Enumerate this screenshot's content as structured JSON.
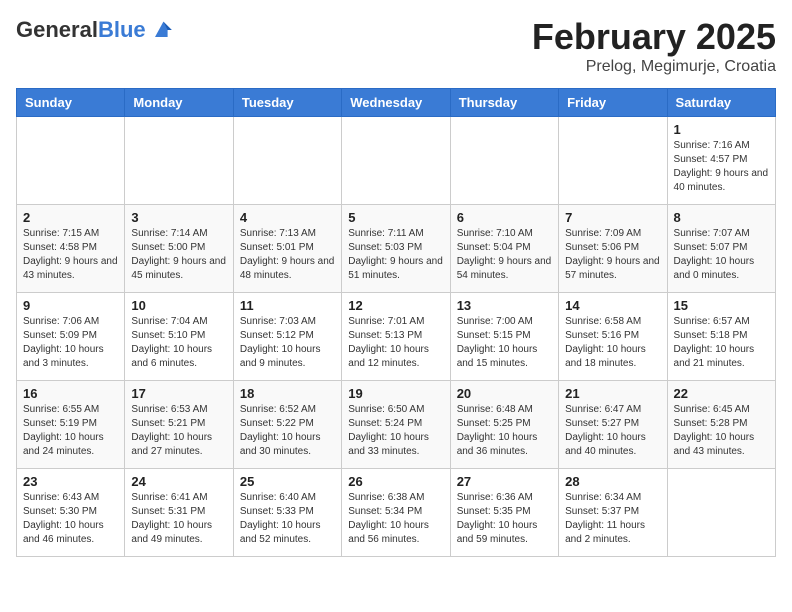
{
  "header": {
    "logo_general": "General",
    "logo_blue": "Blue",
    "month_year": "February 2025",
    "location": "Prelog, Megimurje, Croatia"
  },
  "days_of_week": [
    "Sunday",
    "Monday",
    "Tuesday",
    "Wednesday",
    "Thursday",
    "Friday",
    "Saturday"
  ],
  "weeks": [
    [
      {
        "day": "",
        "info": ""
      },
      {
        "day": "",
        "info": ""
      },
      {
        "day": "",
        "info": ""
      },
      {
        "day": "",
        "info": ""
      },
      {
        "day": "",
        "info": ""
      },
      {
        "day": "",
        "info": ""
      },
      {
        "day": "1",
        "info": "Sunrise: 7:16 AM\nSunset: 4:57 PM\nDaylight: 9 hours and 40 minutes."
      }
    ],
    [
      {
        "day": "2",
        "info": "Sunrise: 7:15 AM\nSunset: 4:58 PM\nDaylight: 9 hours and 43 minutes."
      },
      {
        "day": "3",
        "info": "Sunrise: 7:14 AM\nSunset: 5:00 PM\nDaylight: 9 hours and 45 minutes."
      },
      {
        "day": "4",
        "info": "Sunrise: 7:13 AM\nSunset: 5:01 PM\nDaylight: 9 hours and 48 minutes."
      },
      {
        "day": "5",
        "info": "Sunrise: 7:11 AM\nSunset: 5:03 PM\nDaylight: 9 hours and 51 minutes."
      },
      {
        "day": "6",
        "info": "Sunrise: 7:10 AM\nSunset: 5:04 PM\nDaylight: 9 hours and 54 minutes."
      },
      {
        "day": "7",
        "info": "Sunrise: 7:09 AM\nSunset: 5:06 PM\nDaylight: 9 hours and 57 minutes."
      },
      {
        "day": "8",
        "info": "Sunrise: 7:07 AM\nSunset: 5:07 PM\nDaylight: 10 hours and 0 minutes."
      }
    ],
    [
      {
        "day": "9",
        "info": "Sunrise: 7:06 AM\nSunset: 5:09 PM\nDaylight: 10 hours and 3 minutes."
      },
      {
        "day": "10",
        "info": "Sunrise: 7:04 AM\nSunset: 5:10 PM\nDaylight: 10 hours and 6 minutes."
      },
      {
        "day": "11",
        "info": "Sunrise: 7:03 AM\nSunset: 5:12 PM\nDaylight: 10 hours and 9 minutes."
      },
      {
        "day": "12",
        "info": "Sunrise: 7:01 AM\nSunset: 5:13 PM\nDaylight: 10 hours and 12 minutes."
      },
      {
        "day": "13",
        "info": "Sunrise: 7:00 AM\nSunset: 5:15 PM\nDaylight: 10 hours and 15 minutes."
      },
      {
        "day": "14",
        "info": "Sunrise: 6:58 AM\nSunset: 5:16 PM\nDaylight: 10 hours and 18 minutes."
      },
      {
        "day": "15",
        "info": "Sunrise: 6:57 AM\nSunset: 5:18 PM\nDaylight: 10 hours and 21 minutes."
      }
    ],
    [
      {
        "day": "16",
        "info": "Sunrise: 6:55 AM\nSunset: 5:19 PM\nDaylight: 10 hours and 24 minutes."
      },
      {
        "day": "17",
        "info": "Sunrise: 6:53 AM\nSunset: 5:21 PM\nDaylight: 10 hours and 27 minutes."
      },
      {
        "day": "18",
        "info": "Sunrise: 6:52 AM\nSunset: 5:22 PM\nDaylight: 10 hours and 30 minutes."
      },
      {
        "day": "19",
        "info": "Sunrise: 6:50 AM\nSunset: 5:24 PM\nDaylight: 10 hours and 33 minutes."
      },
      {
        "day": "20",
        "info": "Sunrise: 6:48 AM\nSunset: 5:25 PM\nDaylight: 10 hours and 36 minutes."
      },
      {
        "day": "21",
        "info": "Sunrise: 6:47 AM\nSunset: 5:27 PM\nDaylight: 10 hours and 40 minutes."
      },
      {
        "day": "22",
        "info": "Sunrise: 6:45 AM\nSunset: 5:28 PM\nDaylight: 10 hours and 43 minutes."
      }
    ],
    [
      {
        "day": "23",
        "info": "Sunrise: 6:43 AM\nSunset: 5:30 PM\nDaylight: 10 hours and 46 minutes."
      },
      {
        "day": "24",
        "info": "Sunrise: 6:41 AM\nSunset: 5:31 PM\nDaylight: 10 hours and 49 minutes."
      },
      {
        "day": "25",
        "info": "Sunrise: 6:40 AM\nSunset: 5:33 PM\nDaylight: 10 hours and 52 minutes."
      },
      {
        "day": "26",
        "info": "Sunrise: 6:38 AM\nSunset: 5:34 PM\nDaylight: 10 hours and 56 minutes."
      },
      {
        "day": "27",
        "info": "Sunrise: 6:36 AM\nSunset: 5:35 PM\nDaylight: 10 hours and 59 minutes."
      },
      {
        "day": "28",
        "info": "Sunrise: 6:34 AM\nSunset: 5:37 PM\nDaylight: 11 hours and 2 minutes."
      },
      {
        "day": "",
        "info": ""
      }
    ]
  ]
}
